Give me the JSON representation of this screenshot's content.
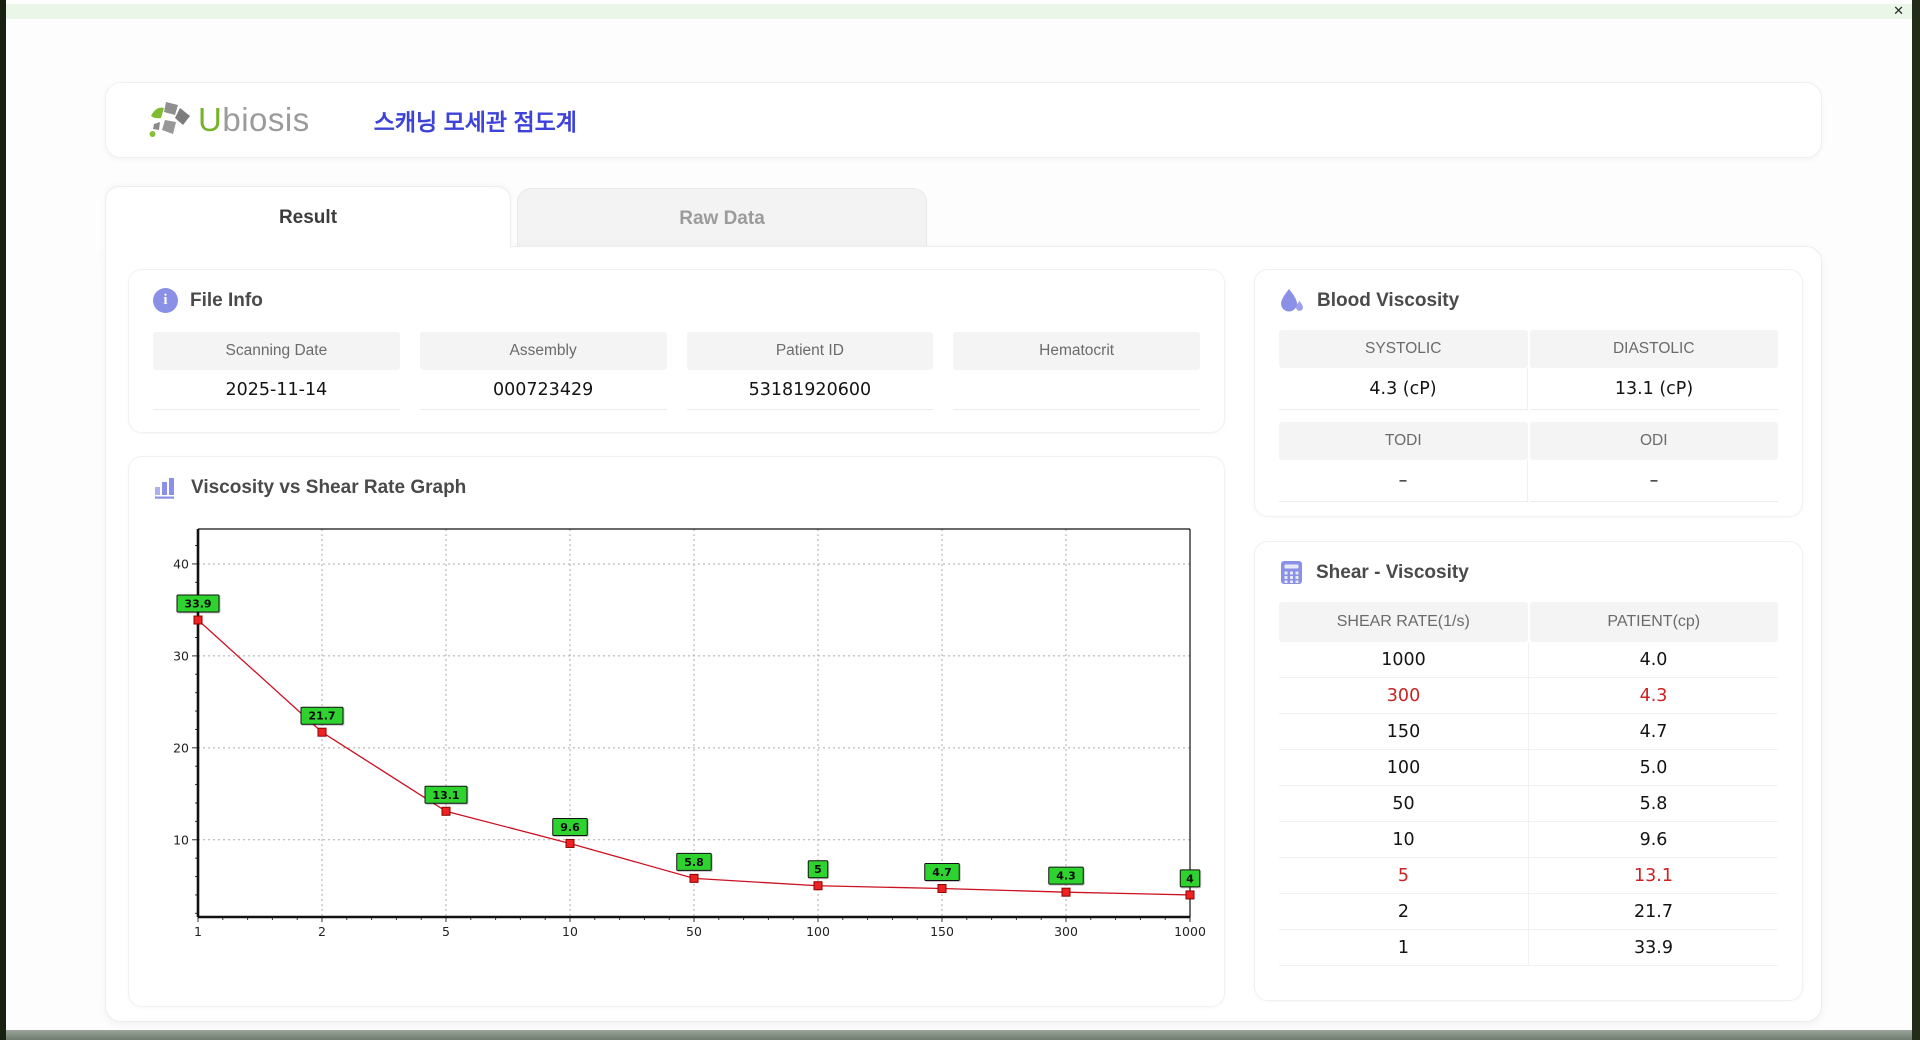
{
  "window": {
    "close_label": "✕"
  },
  "header": {
    "logo_primary": "U",
    "logo_secondary": "biosis",
    "app_title": "스캐닝 모세관 점도계"
  },
  "tabs": [
    {
      "label": "Result",
      "active": true
    },
    {
      "label": "Raw Data",
      "active": false
    }
  ],
  "file_info": {
    "title": "File Info",
    "fields": [
      {
        "label": "Scanning Date",
        "value": "2025-11-14"
      },
      {
        "label": "Assembly",
        "value": "000723429"
      },
      {
        "label": "Patient ID",
        "value": "53181920600"
      },
      {
        "label": "Hematocrit",
        "value": ""
      }
    ]
  },
  "blood_viscosity": {
    "title": "Blood Viscosity",
    "rows": [
      {
        "cols": [
          {
            "label": "SYSTOLIC",
            "value": "4.3 (cP)"
          },
          {
            "label": "DIASTOLIC",
            "value": "13.1 (cP)"
          }
        ]
      },
      {
        "cols": [
          {
            "label": "TODI",
            "value": "–"
          },
          {
            "label": "ODI",
            "value": "–"
          }
        ]
      }
    ]
  },
  "shear_viscosity": {
    "title": "Shear - Viscosity",
    "columns": [
      "SHEAR RATE(1/s)",
      "PATIENT(cp)"
    ],
    "highlight_color": "#cc2222",
    "rows": [
      {
        "shear_rate": "1000",
        "patient": "4.0",
        "highlight": false
      },
      {
        "shear_rate": "300",
        "patient": "4.3",
        "highlight": true
      },
      {
        "shear_rate": "150",
        "patient": "4.7",
        "highlight": false
      },
      {
        "shear_rate": "100",
        "patient": "5.0",
        "highlight": false
      },
      {
        "shear_rate": "50",
        "patient": "5.8",
        "highlight": false
      },
      {
        "shear_rate": "10",
        "patient": "9.6",
        "highlight": false
      },
      {
        "shear_rate": "5",
        "patient": "13.1",
        "highlight": true
      },
      {
        "shear_rate": "2",
        "patient": "21.7",
        "highlight": false
      },
      {
        "shear_rate": "1",
        "patient": "33.9",
        "highlight": false
      }
    ]
  },
  "chart_data": {
    "type": "line",
    "title": "Viscosity vs Shear Rate Graph",
    "xlabel": "",
    "ylabel": "",
    "x_axis_type": "categorical",
    "categories": [
      1,
      2,
      5,
      10,
      50,
      100,
      150,
      300,
      1000
    ],
    "values": [
      33.9,
      21.7,
      13.1,
      9.6,
      5.8,
      5,
      4.7,
      4.3,
      4
    ],
    "point_labels": [
      "33.9",
      "21.7",
      "13.1",
      "9.6",
      "5.8",
      "5",
      "4.7",
      "4.3",
      "4"
    ],
    "y_ticks": [
      10,
      20,
      30,
      40
    ],
    "ylim": [
      1.6,
      43.8
    ],
    "grid": "dashed",
    "legend": "none",
    "line_color": "#cc1122",
    "marker_color": "#ee2222",
    "marker_edge_color": "#8b0000",
    "label_bg_color": "#2fd32f"
  }
}
